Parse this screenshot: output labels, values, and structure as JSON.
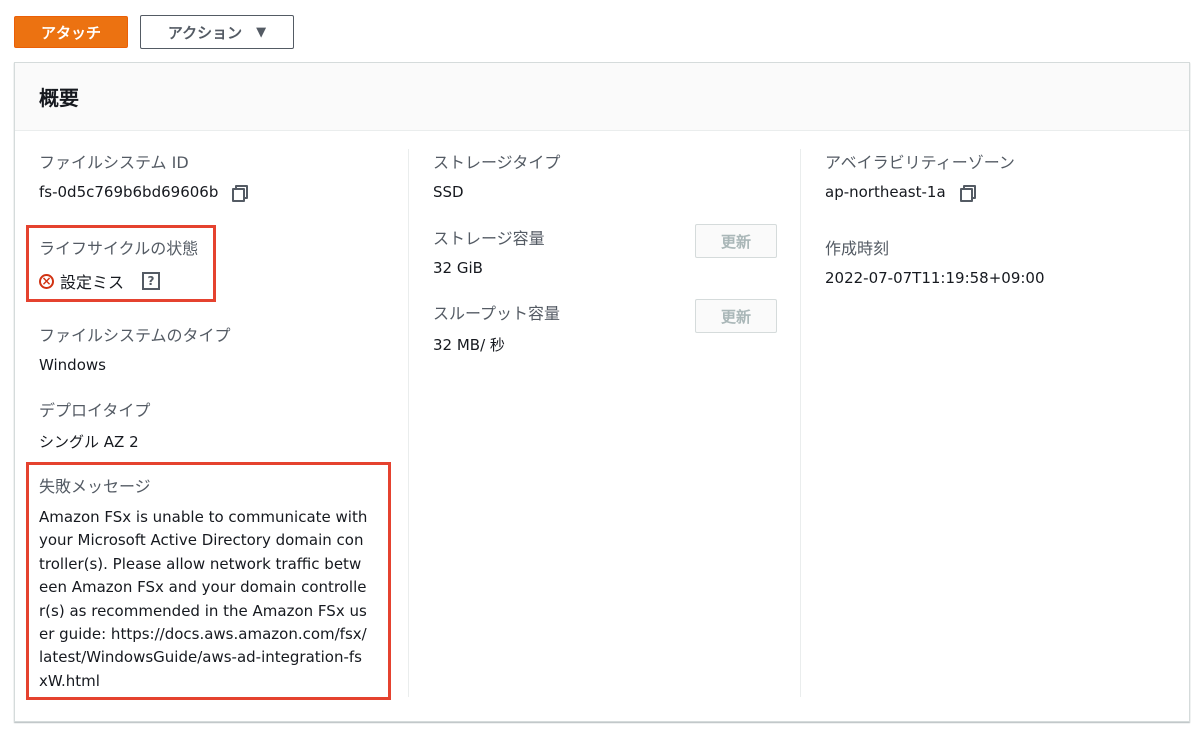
{
  "toolbar": {
    "attach_label": "アタッチ",
    "actions_label": "アクション",
    "actions_caret": "▼"
  },
  "panel": {
    "title": "概要"
  },
  "col1": {
    "fs_id_label": "ファイルシステム ID",
    "fs_id_value": "fs-0d5c769b6bd69606b",
    "lifecycle_label": "ライフサイクルの状態",
    "lifecycle_value": "設定ミス",
    "lifecycle_help": "?",
    "fs_type_label": "ファイルシステムのタイプ",
    "fs_type_value": "Windows",
    "deploy_label": "デプロイタイプ",
    "deploy_value": "シングル AZ 2",
    "failure_label": "失敗メッセージ",
    "failure_value": "Amazon FSx is unable to communicate with your Microsoft Active Directory domain controller(s). Please allow network traffic between Amazon FSx and your domain controller(s) as recommended in the Amazon FSx user guide: https://docs.aws.amazon.com/fsx/latest/WindowsGuide/aws-ad-integration-fsxW.html"
  },
  "col2": {
    "storage_type_label": "ストレージタイプ",
    "storage_type_value": "SSD",
    "storage_capacity_label": "ストレージ容量",
    "storage_capacity_value": "32 GiB",
    "throughput_label": "スループット容量",
    "throughput_value": "32 MB/ 秒",
    "update_label": "更新"
  },
  "col3": {
    "az_label": "アベイラビリティーゾーン",
    "az_value": "ap-northeast-1a",
    "created_label": "作成時刻",
    "created_value": "2022-07-07T11:19:58+09:00"
  },
  "colors": {
    "primary": "#ec7211",
    "highlight": "#e5422f",
    "error": "#d13212"
  },
  "icons": [
    "copy-icon",
    "error-circle-icon",
    "help-icon",
    "caret-down-icon"
  ]
}
